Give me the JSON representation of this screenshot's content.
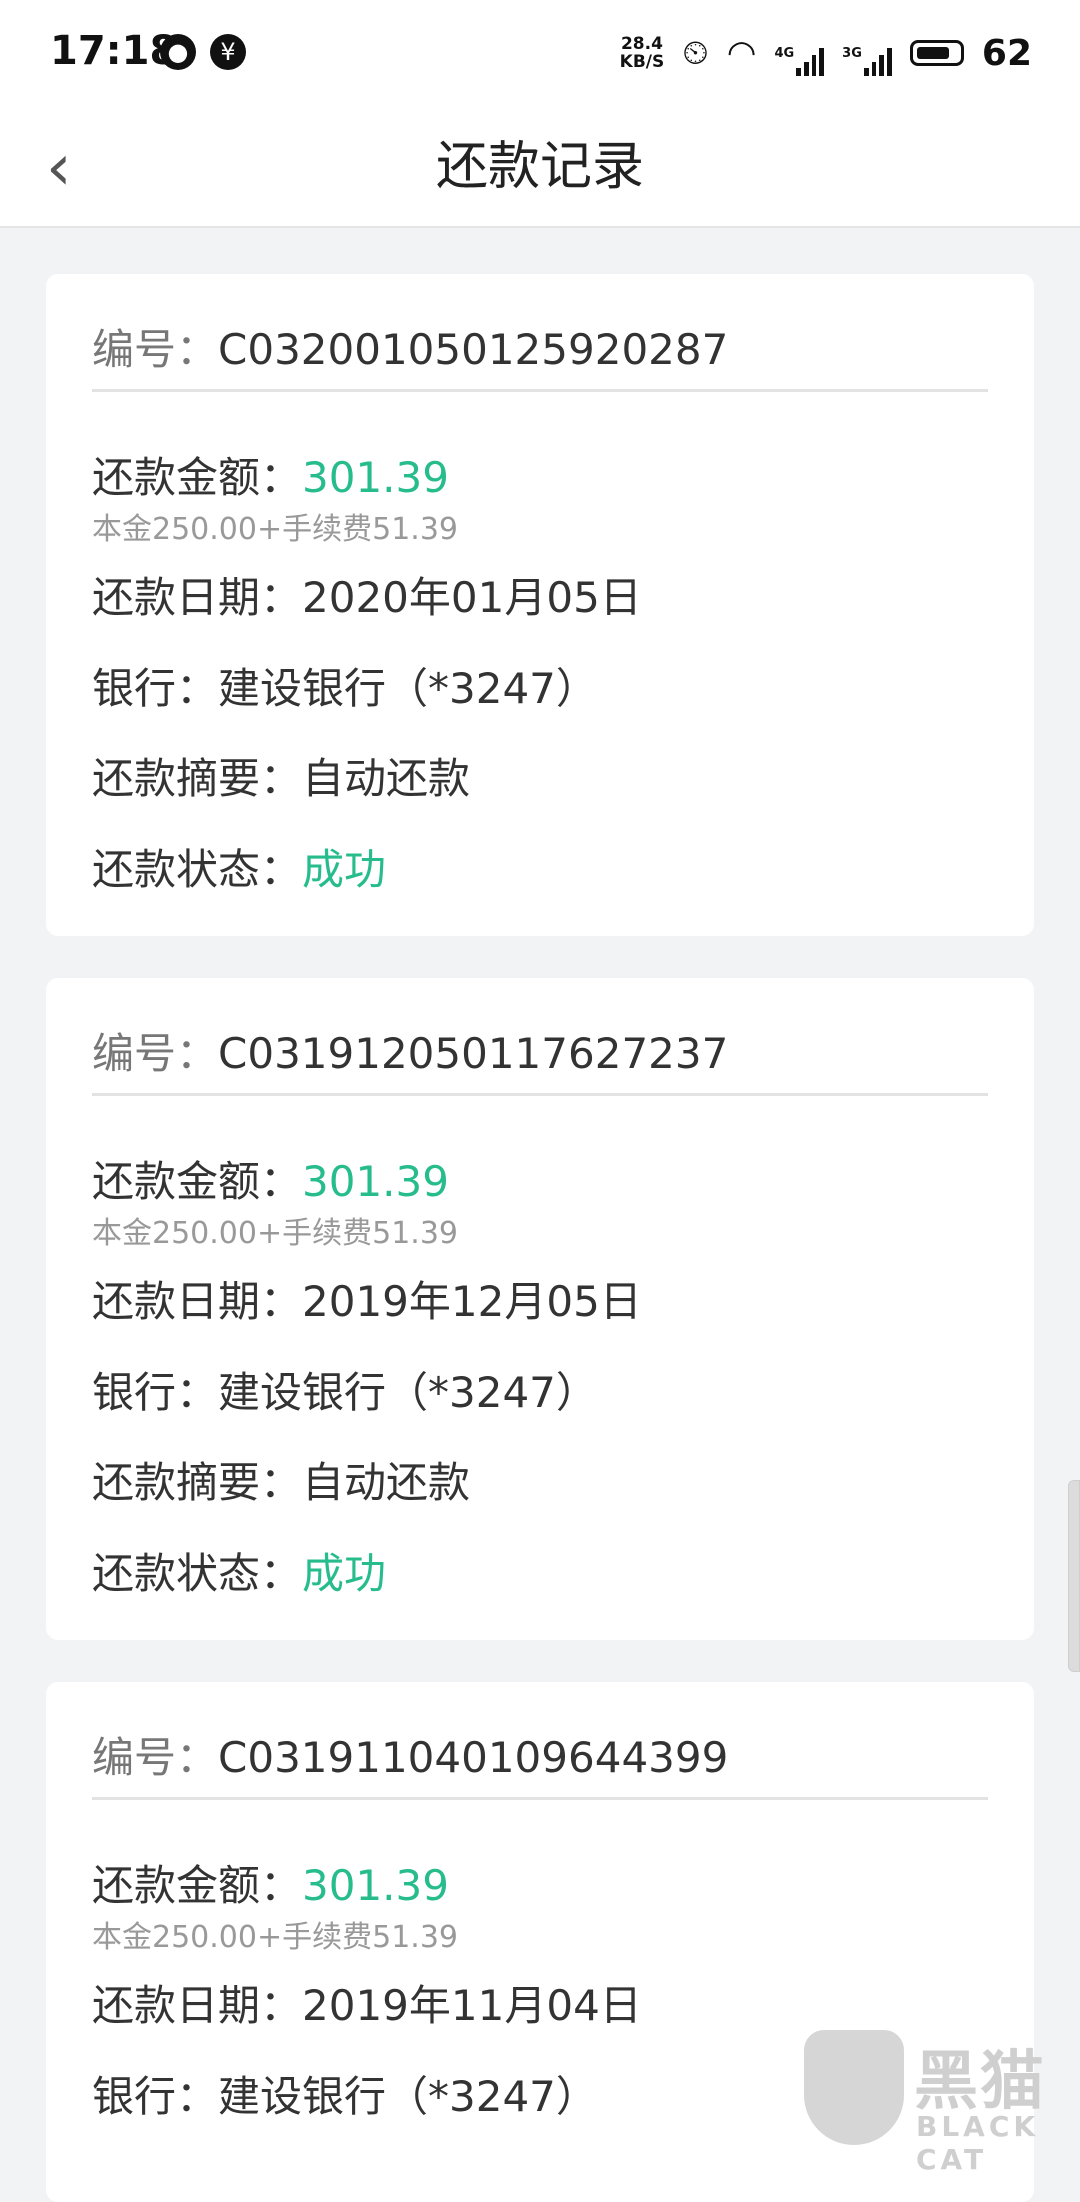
{
  "status_bar": {
    "time": "17:18",
    "speed_value": "28.4",
    "speed_unit": "KB/S",
    "net1": "4G",
    "net2": "3G",
    "battery": "62"
  },
  "header": {
    "title": "还款记录"
  },
  "labels": {
    "number": "编号：",
    "amount": "还款金额：",
    "date": "还款日期：",
    "bank": "银行：",
    "summary": "还款摘要：",
    "status": "还款状态："
  },
  "records": [
    {
      "number": "C032001050125920287",
      "amount": "301.39",
      "breakdown": "本金250.00+手续费51.39",
      "date": "2020年01月05日",
      "bank": "建设银行（*3247）",
      "summary": "自动还款",
      "status": "成功"
    },
    {
      "number": "C031912050117627237",
      "amount": "301.39",
      "breakdown": "本金250.00+手续费51.39",
      "date": "2019年12月05日",
      "bank": "建设银行（*3247）",
      "summary": "自动还款",
      "status": "成功"
    },
    {
      "number": "C031911040109644399",
      "amount": "301.39",
      "breakdown": "本金250.00+手续费51.39",
      "date": "2019年11月04日",
      "bank": "建设银行（*3247）"
    }
  ],
  "watermark": {
    "cn": "黑猫",
    "en": "BLACK CAT"
  },
  "colors": {
    "accent_green": "#27bc8c",
    "background": "#f2f3f4"
  }
}
